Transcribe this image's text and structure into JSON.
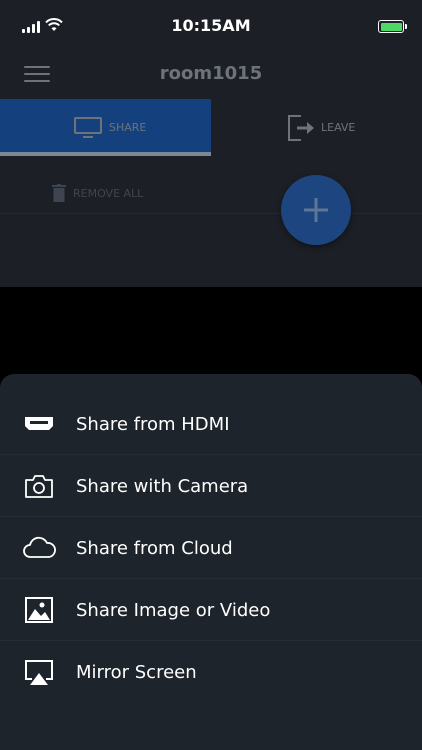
{
  "status_bar": {
    "time": "10:15AM"
  },
  "nav": {
    "title": "room1015"
  },
  "tabs": {
    "share_label": "SHARE",
    "leave_label": "LEAVE"
  },
  "actions": {
    "remove_all_label": "REMOVE ALL"
  },
  "sheet": {
    "items": [
      {
        "label": "Share from HDMI",
        "icon": "hdmi-icon"
      },
      {
        "label": "Share with Camera",
        "icon": "camera-icon"
      },
      {
        "label": "Share from Cloud",
        "icon": "cloud-icon"
      },
      {
        "label": "Share Image or Video",
        "icon": "image-icon"
      },
      {
        "label": "Mirror Screen",
        "icon": "airplay-icon"
      }
    ]
  },
  "colors": {
    "accent": "#14407e",
    "fab": "#1d4680",
    "battery": "#4cd964",
    "sheet_background": "#1e242b"
  }
}
